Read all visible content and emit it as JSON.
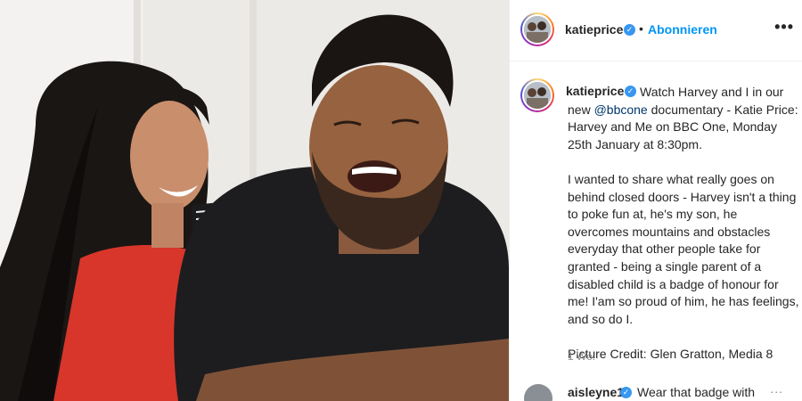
{
  "post": {
    "image_alt": "",
    "header": {
      "username": "katieprice",
      "separator": "•",
      "follow_label": "Abonnieren",
      "more_label": "•••"
    },
    "caption": {
      "username": "katieprice",
      "pre_mention": "Watch Harvey and I in our new",
      "mention": "@bbcone",
      "post_mention": "documentary - Katie Price: Harvey and Me on BBC One, Monday 25th January at 8:30pm.",
      "paragraph_2": "I wanted to share what really goes on behind closed doors - Harvey isn't a thing to poke fun at, he's my son, he overcomes mountains and obstacles everyday that other people take for granted - being a single parent of a disabled child is a badge of honour for me! I'am so proud of him, he has feelings, and so do I.",
      "paragraph_3": "Picture Credit: Glen Gratton, Media 8",
      "time": "1 Wo."
    },
    "comment": {
      "username": "aisleyne1",
      "text": "Wear that badge with",
      "more_label": "..."
    }
  },
  "colors": {
    "link": "#0095f6",
    "mention": "#00376b",
    "verified": "#3897f0",
    "muted": "#8e8e8e"
  },
  "icons": {
    "verified": "verified-badge-icon",
    "more": "more-options-icon"
  }
}
